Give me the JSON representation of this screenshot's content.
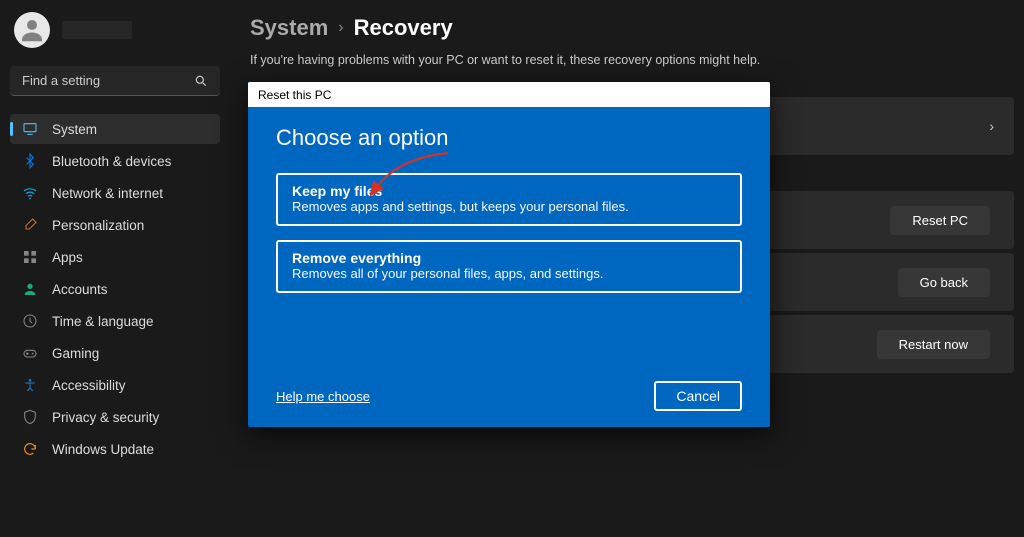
{
  "search": {
    "placeholder": "Find a setting"
  },
  "nav": [
    {
      "label": "System",
      "icon": "system",
      "color": "#4cc2ff",
      "active": true
    },
    {
      "label": "Bluetooth & devices",
      "icon": "bluetooth",
      "color": "#0372d8"
    },
    {
      "label": "Network & internet",
      "icon": "wifi",
      "color": "#0aa7e4"
    },
    {
      "label": "Personalization",
      "icon": "brush",
      "color": "#d06f33"
    },
    {
      "label": "Apps",
      "icon": "apps",
      "color": "#868686"
    },
    {
      "label": "Accounts",
      "icon": "account",
      "color": "#19ab79"
    },
    {
      "label": "Time & language",
      "icon": "clock",
      "color": "#868686"
    },
    {
      "label": "Gaming",
      "icon": "gaming",
      "color": "#868686"
    },
    {
      "label": "Accessibility",
      "icon": "access",
      "color": "#1e80cf"
    },
    {
      "label": "Privacy & security",
      "icon": "shield",
      "color": "#868686"
    },
    {
      "label": "Windows Update",
      "icon": "update",
      "color": "#eb8b26"
    }
  ],
  "breadcrumb": {
    "parent": "System",
    "current": "Recovery"
  },
  "subtitle": "If you're having problems with your PC or want to reset it, these recovery options might help.",
  "cards": {
    "resetBtn": "Reset PC",
    "goBackBtn": "Go back",
    "restartBtn": "Restart now"
  },
  "dialog": {
    "titlebar": "Reset this PC",
    "heading": "Choose an option",
    "options": [
      {
        "title": "Keep my files",
        "desc": "Removes apps and settings, but keeps your personal files."
      },
      {
        "title": "Remove everything",
        "desc": "Removes all of your personal files, apps, and settings."
      }
    ],
    "help": "Help me choose",
    "cancel": "Cancel"
  }
}
